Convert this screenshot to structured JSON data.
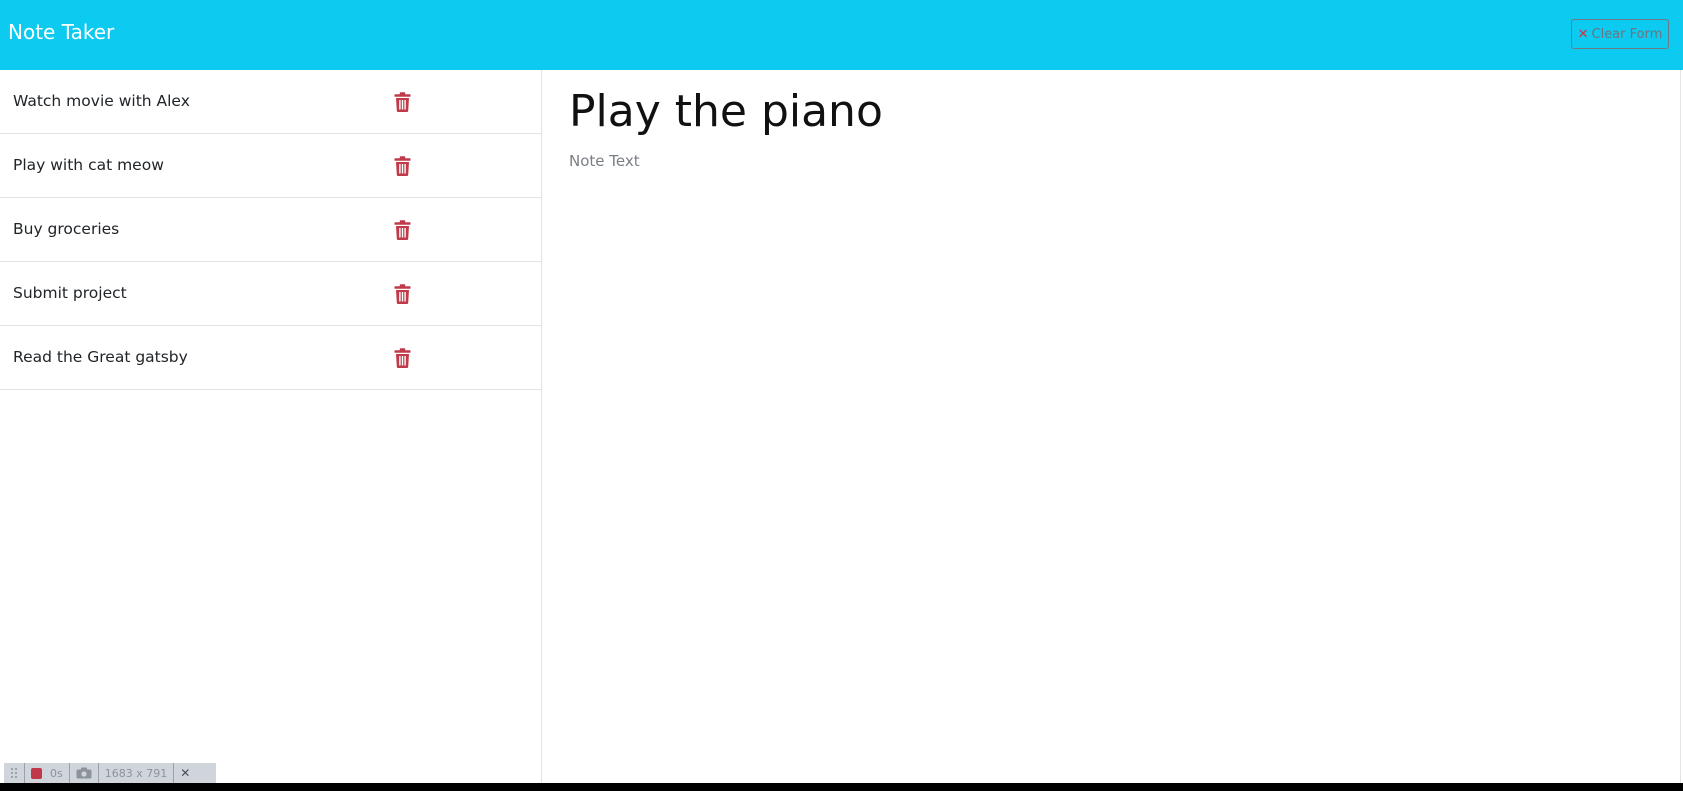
{
  "app": {
    "title": "Note Taker"
  },
  "header": {
    "clear_label": "Clear Form",
    "clear_icon": "x-icon"
  },
  "notes": [
    {
      "title": "Watch movie with Alex",
      "icon": "trash-icon"
    },
    {
      "title": "Play with cat meow",
      "icon": "trash-icon"
    },
    {
      "title": "Buy groceries",
      "icon": "trash-icon"
    },
    {
      "title": "Submit project",
      "icon": "trash-icon"
    },
    {
      "title": "Read the Great gatsby",
      "icon": "trash-icon"
    }
  ],
  "editor": {
    "title_value": "Play the piano",
    "text_placeholder": "Note Text"
  },
  "recorder": {
    "time": "0s",
    "size": "1683 x 791"
  },
  "colors": {
    "navbar": "#0dcaf0",
    "delete": "#c0394a",
    "clear_icon": "#d9303e"
  }
}
